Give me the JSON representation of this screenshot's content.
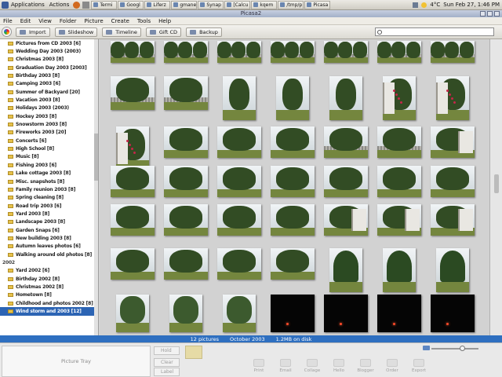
{
  "top_panel": {
    "applications": "Applications",
    "actions": "Actions",
    "tasks": [
      "Termi",
      "Googl",
      "Liferz",
      "gmane",
      "Synap",
      "[Calcu",
      "kqem",
      "/tmp/p",
      "Picasa"
    ],
    "weather": "4°C",
    "datetime": "Sun Feb 27, 1:46 PM"
  },
  "window": {
    "title": "Picasa2"
  },
  "menu": [
    "File",
    "Edit",
    "View",
    "Folder",
    "Picture",
    "Create",
    "Tools",
    "Help"
  ],
  "toolbar": {
    "import": "Import",
    "slideshow": "Slideshow",
    "timeline": "Timeline",
    "gift_cd": "Gift CD",
    "backup": "Backup",
    "search_placeholder": ""
  },
  "sidebar": {
    "items": [
      {
        "label": "Pictures from CD 2003 [6]",
        "type": "folder"
      },
      {
        "label": "Wedding Day 2003 (2003)",
        "type": "folder"
      },
      {
        "label": "Christmas 2003 [8]",
        "type": "folder"
      },
      {
        "label": "Graduation Day 2003 [2003]",
        "type": "folder"
      },
      {
        "label": "Birthday 2003 [8]",
        "type": "folder"
      },
      {
        "label": "Camping 2003 [6]",
        "type": "folder"
      },
      {
        "label": "Summer of Backyard [20]",
        "type": "folder"
      },
      {
        "label": "Vacation 2003 [8]",
        "type": "folder"
      },
      {
        "label": "Holidays 2003 (2003)",
        "type": "folder"
      },
      {
        "label": "Hockey 2003 [8]",
        "type": "folder"
      },
      {
        "label": "Snowstorm 2003 [8]",
        "type": "folder"
      },
      {
        "label": "Fireworks 2003 [20]",
        "type": "folder"
      },
      {
        "label": "Concerts [6]",
        "type": "folder"
      },
      {
        "label": "High School [8]",
        "type": "folder"
      },
      {
        "label": "Music [8]",
        "type": "folder"
      },
      {
        "label": "Fishing 2003 [6]",
        "type": "folder"
      },
      {
        "label": "Lake cottage 2003 [8]",
        "type": "folder"
      },
      {
        "label": "Misc. snapshots [8]",
        "type": "folder"
      },
      {
        "label": "Family reunion 2003 [8]",
        "type": "folder"
      },
      {
        "label": "Spring cleaning [8]",
        "type": "folder"
      },
      {
        "label": "Road trip 2003 [6]",
        "type": "folder"
      },
      {
        "label": "Yard 2003 [8]",
        "type": "folder"
      },
      {
        "label": "Landscape 2003 [8]",
        "type": "folder"
      },
      {
        "label": "Garden Snaps [6]",
        "type": "folder"
      },
      {
        "label": "New building 2003 [8]",
        "type": "folder"
      },
      {
        "label": "Autumn leaves photos [6]",
        "type": "folder"
      },
      {
        "label": "Walking around old photos [8]",
        "type": "folder"
      },
      {
        "label": "2002",
        "type": "group"
      },
      {
        "label": "Yard 2002 [6]",
        "type": "folder"
      },
      {
        "label": "Birthday 2002 [8]",
        "type": "folder"
      },
      {
        "label": "Christmas 2002 [8]",
        "type": "folder"
      },
      {
        "label": "Hometown [8]",
        "type": "folder"
      },
      {
        "label": "Childhood and photos 2002 [8]",
        "type": "folder"
      },
      {
        "label": "Wind storm and 2003 [12]",
        "type": "selected"
      }
    ]
  },
  "status": {
    "count": "12 pictures",
    "date": "October 2003",
    "size": "1.2MB on disk"
  },
  "tray": {
    "label": "Picture Tray",
    "hold": "Hold",
    "clear": "Clear",
    "label_btn": "Label",
    "actions": [
      "Print",
      "Email",
      "Collage",
      "Hello",
      "Blogger",
      "Order",
      "Export"
    ]
  }
}
